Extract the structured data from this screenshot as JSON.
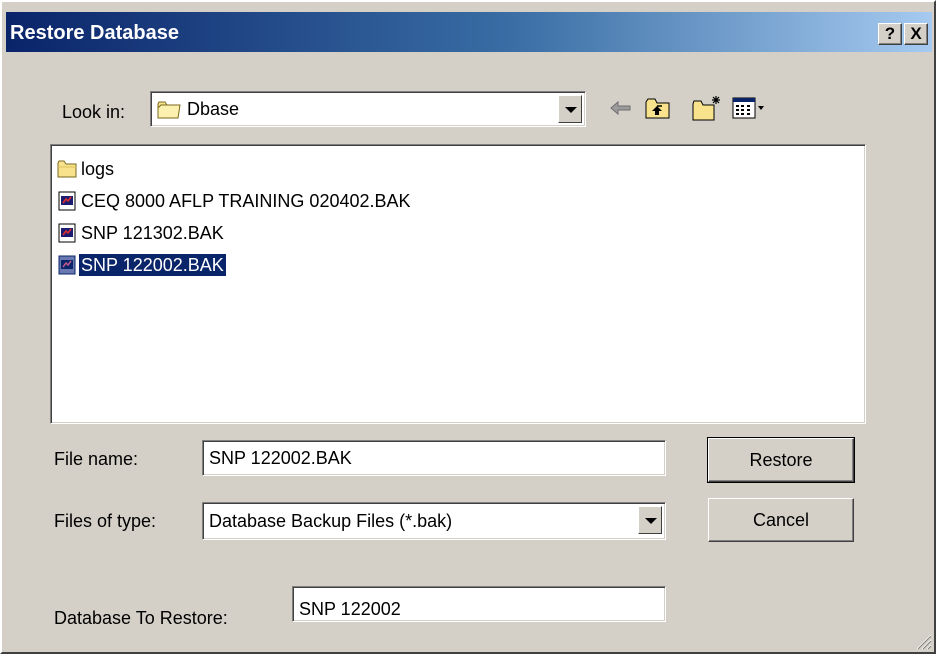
{
  "window": {
    "title": "Restore Database",
    "help_btn": "?",
    "close_btn": "X"
  },
  "look_in": {
    "label": "Look in:",
    "value": "Dbase"
  },
  "files": [
    {
      "name": "logs",
      "icon": "folder-icon",
      "selected": false
    },
    {
      "name": "CEQ 8000 AFLP TRAINING 020402.BAK",
      "icon": "backup-file-icon",
      "selected": false
    },
    {
      "name": "SNP 121302.BAK",
      "icon": "backup-file-icon",
      "selected": false
    },
    {
      "name": "SNP 122002.BAK",
      "icon": "backup-file-icon",
      "selected": true
    }
  ],
  "file_name": {
    "label": "File name:",
    "value": "SNP 122002.BAK"
  },
  "file_type": {
    "label": "Files of type:",
    "value": "Database Backup Files (*.bak)"
  },
  "database_to_restore": {
    "label": "Database To Restore:",
    "value": "SNP 122002"
  },
  "buttons": {
    "restore": "Restore",
    "cancel": "Cancel"
  },
  "colors": {
    "title_start": "#0a246a",
    "title_end": "#a6caf0",
    "dialog_bg": "#d4d0c8",
    "selection": "#0a246a"
  }
}
